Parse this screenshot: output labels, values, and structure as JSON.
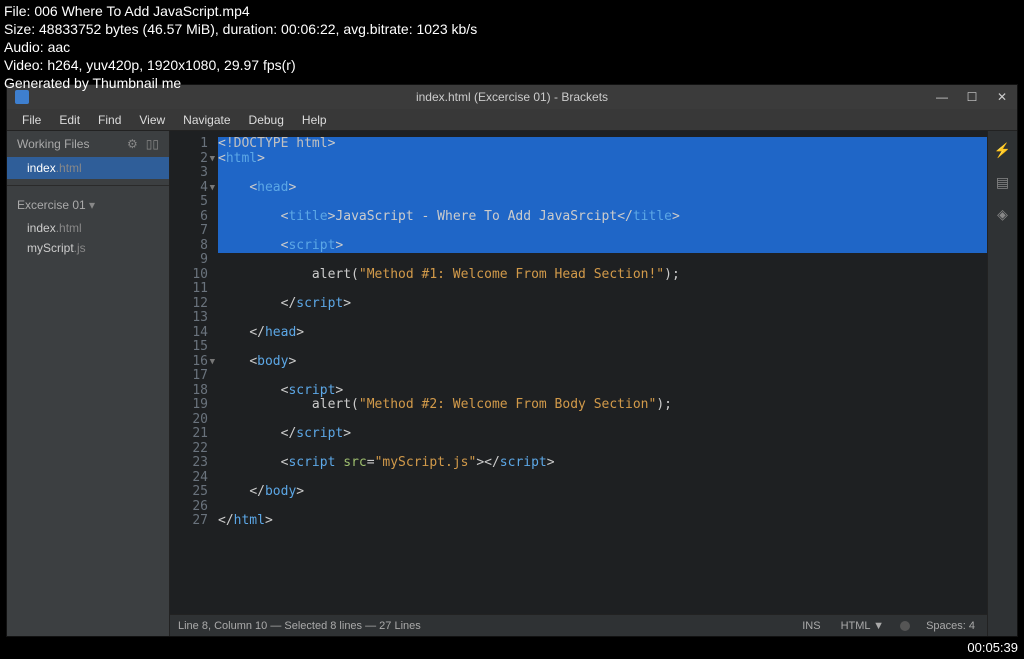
{
  "video_info": {
    "line1": "File: 006 Where To Add JavaScript.mp4",
    "line2": "Size: 48833752 bytes (46.57 MiB), duration: 00:06:22, avg.bitrate: 1023 kb/s",
    "line3": "Audio: aac",
    "line4": "Video: h264, yuv420p, 1920x1080, 29.97 fps(r)",
    "line5": "Generated by Thumbnail me"
  },
  "title_bar": "index.html (Excercise 01) - Brackets",
  "menu": [
    "File",
    "Edit",
    "Find",
    "View",
    "Navigate",
    "Debug",
    "Help"
  ],
  "sidebar": {
    "working_label": "Working Files",
    "working_files": [
      {
        "name": "index",
        "ext": ".html",
        "active": true
      }
    ],
    "project_label": "Excercise 01 ",
    "project_files": [
      {
        "name": "index",
        "ext": ".html"
      },
      {
        "name": "myScript",
        "ext": ".js"
      }
    ]
  },
  "editor": {
    "selection_start": 1,
    "selection_end": 8,
    "lines": [
      {
        "n": 1,
        "fold": "",
        "tokens": [
          [
            "t-punc",
            "<"
          ],
          [
            "t-doctype",
            "!DOCTYPE html"
          ],
          [
            "t-punc",
            ">"
          ]
        ]
      },
      {
        "n": 2,
        "fold": "▼",
        "tokens": [
          [
            "t-punc",
            "<"
          ],
          [
            "t-tag",
            "html"
          ],
          [
            "t-punc",
            ">"
          ]
        ]
      },
      {
        "n": 3,
        "fold": "",
        "tokens": []
      },
      {
        "n": 4,
        "fold": "▼",
        "indent": 1,
        "tokens": [
          [
            "t-punc",
            "<"
          ],
          [
            "t-tag",
            "head"
          ],
          [
            "t-punc",
            ">"
          ]
        ]
      },
      {
        "n": 5,
        "fold": "",
        "tokens": []
      },
      {
        "n": 6,
        "fold": "",
        "indent": 2,
        "tokens": [
          [
            "t-punc",
            "<"
          ],
          [
            "t-tag",
            "title"
          ],
          [
            "t-punc",
            ">"
          ],
          [
            "t-text",
            "JavaScript - Where To Add JavaSrcipt"
          ],
          [
            "t-punc",
            "</"
          ],
          [
            "t-tag",
            "title"
          ],
          [
            "t-punc",
            ">"
          ]
        ]
      },
      {
        "n": 7,
        "fold": "",
        "tokens": []
      },
      {
        "n": 8,
        "fold": "",
        "indent": 2,
        "tokens": [
          [
            "t-punc",
            "<"
          ],
          [
            "t-tag",
            "script"
          ],
          [
            "t-punc",
            ">"
          ]
        ]
      },
      {
        "n": 9,
        "fold": "",
        "tokens": []
      },
      {
        "n": 10,
        "fold": "",
        "indent": 3,
        "tokens": [
          [
            "t-text",
            "alert("
          ],
          [
            "t-string",
            "\"Method #1: Welcome From Head Section!\""
          ],
          [
            "t-text",
            ");"
          ]
        ]
      },
      {
        "n": 11,
        "fold": "",
        "tokens": []
      },
      {
        "n": 12,
        "fold": "",
        "indent": 2,
        "tokens": [
          [
            "t-punc",
            "</"
          ],
          [
            "t-tag",
            "script"
          ],
          [
            "t-punc",
            ">"
          ]
        ]
      },
      {
        "n": 13,
        "fold": "",
        "tokens": []
      },
      {
        "n": 14,
        "fold": "",
        "indent": 1,
        "tokens": [
          [
            "t-punc",
            "</"
          ],
          [
            "t-tag",
            "head"
          ],
          [
            "t-punc",
            ">"
          ]
        ]
      },
      {
        "n": 15,
        "fold": "",
        "tokens": []
      },
      {
        "n": 16,
        "fold": "▼",
        "indent": 1,
        "tokens": [
          [
            "t-punc",
            "<"
          ],
          [
            "t-tag",
            "body"
          ],
          [
            "t-punc",
            ">"
          ]
        ]
      },
      {
        "n": 17,
        "fold": "",
        "tokens": []
      },
      {
        "n": 18,
        "fold": "",
        "indent": 2,
        "tokens": [
          [
            "t-punc",
            "<"
          ],
          [
            "t-tag",
            "script"
          ],
          [
            "t-punc",
            ">"
          ]
        ]
      },
      {
        "n": 19,
        "fold": "",
        "indent": 3,
        "tokens": [
          [
            "t-text",
            "alert("
          ],
          [
            "t-string",
            "\"Method #2: Welcome From Body Section\""
          ],
          [
            "t-text",
            ");"
          ]
        ]
      },
      {
        "n": 20,
        "fold": "",
        "tokens": []
      },
      {
        "n": 21,
        "fold": "",
        "indent": 2,
        "tokens": [
          [
            "t-punc",
            "</"
          ],
          [
            "t-tag",
            "script"
          ],
          [
            "t-punc",
            ">"
          ]
        ]
      },
      {
        "n": 22,
        "fold": "",
        "tokens": []
      },
      {
        "n": 23,
        "fold": "",
        "indent": 2,
        "tokens": [
          [
            "t-punc",
            "<"
          ],
          [
            "t-tag",
            "script"
          ],
          [
            "t-text",
            " "
          ],
          [
            "t-attr",
            "src"
          ],
          [
            "t-punc",
            "="
          ],
          [
            "t-string",
            "\"myScript.js\""
          ],
          [
            "t-punc",
            "></"
          ],
          [
            "t-tag",
            "script"
          ],
          [
            "t-punc",
            ">"
          ]
        ]
      },
      {
        "n": 24,
        "fold": "",
        "tokens": []
      },
      {
        "n": 25,
        "fold": "",
        "indent": 1,
        "tokens": [
          [
            "t-punc",
            "</"
          ],
          [
            "t-tag",
            "body"
          ],
          [
            "t-punc",
            ">"
          ]
        ]
      },
      {
        "n": 26,
        "fold": "",
        "tokens": []
      },
      {
        "n": 27,
        "fold": "",
        "tokens": [
          [
            "t-punc",
            "</"
          ],
          [
            "t-tag",
            "html"
          ],
          [
            "t-punc",
            ">"
          ]
        ]
      }
    ]
  },
  "status": {
    "left": "Line 8, Column 10 — Selected 8 lines — 27 Lines",
    "ins": "INS",
    "lang": "HTML ▼",
    "spaces": "Spaces: 4"
  },
  "timestamp": "00:05:39"
}
